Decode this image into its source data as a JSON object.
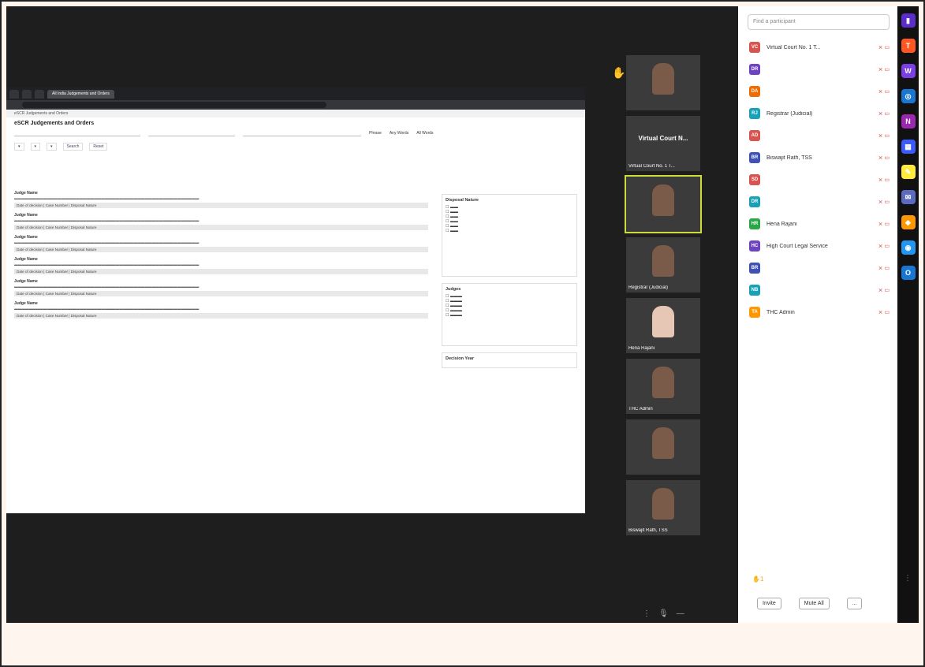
{
  "browser": {
    "tabs": [
      "",
      "",
      "",
      "All India Judgements and Orders"
    ],
    "url": "",
    "subbar": "eSCR Judgements and Orders"
  },
  "app": {
    "title": "eSCR Judgements and Orders",
    "search_placeholder": "",
    "radios": [
      "Phrase",
      "Any Words",
      "All Words"
    ],
    "tools": [
      "Search",
      "Reset"
    ]
  },
  "results": [
    {
      "title": "",
      "meta": "Judge Name",
      "bar": "Date of decision | Case Number | Disposal Nature"
    },
    {
      "title": "",
      "meta": "Judge Name",
      "bar": "Date of decision | Case Number | Disposal Nature"
    },
    {
      "title": "",
      "meta": "Judge Name",
      "bar": "Date of decision | Case Number | Disposal Nature"
    },
    {
      "title": "",
      "meta": "Judge Name",
      "bar": "Date of decision | Case Number | Disposal Nature"
    },
    {
      "title": "",
      "meta": "Judge Name",
      "bar": "Date of decision | Case Number | Disposal Nature"
    },
    {
      "title": "",
      "meta": "Judge Name",
      "bar": "Date of decision | Case Number | Disposal Nature"
    }
  ],
  "filters": {
    "box1_title": "Disposal Nature",
    "box2_title": "Judges",
    "box3_title": "Decision Year"
  },
  "videos": [
    {
      "name": "",
      "label": ""
    },
    {
      "name": "Virtual Court No. 1 T...",
      "label": "Virtual Court N..."
    },
    {
      "name": "",
      "label": ""
    },
    {
      "name": "Registrar (Judicial)",
      "label": ""
    },
    {
      "name": "Hena Rajani",
      "label": ""
    },
    {
      "name": "THC Admin",
      "label": ""
    },
    {
      "name": "",
      "label": ""
    },
    {
      "name": "Biswajit Rath, TSS",
      "label": ""
    }
  ],
  "participants": {
    "search_placeholder": "Find a participant",
    "items": [
      {
        "initials": "VC",
        "name": "Virtual Court No. 1 T...",
        "color": "#d9534f"
      },
      {
        "initials": "DR",
        "name": "",
        "color": "#6f42c1"
      },
      {
        "initials": "DA",
        "name": "",
        "color": "#ef6c00"
      },
      {
        "initials": "RJ",
        "name": "Registrar (Judicial)",
        "color": "#17a2b8"
      },
      {
        "initials": "AD",
        "name": "",
        "color": "#d9534f"
      },
      {
        "initials": "BR",
        "name": "Biswajit Rath, TSS",
        "color": "#3f51b5"
      },
      {
        "initials": "SD",
        "name": "",
        "color": "#d9534f"
      },
      {
        "initials": "DR",
        "name": "",
        "color": "#17a2b8"
      },
      {
        "initials": "HR",
        "name": "Hena Rajani",
        "color": "#28a745"
      },
      {
        "initials": "HC",
        "name": "High Court Legal Service",
        "color": "#6f42c1"
      },
      {
        "initials": "BR",
        "name": "",
        "color": "#3f51b5"
      },
      {
        "initials": "NB",
        "name": "",
        "color": "#17a2b8"
      },
      {
        "initials": "TA",
        "name": "THC Admin",
        "color": "#ff9800"
      }
    ],
    "raised_count": "1",
    "invite_label": "Invite",
    "mute_all_label": "Mute All",
    "more_label": "..."
  },
  "controls": [
    "⋮",
    "🎙",
    "—"
  ],
  "dock": [
    {
      "icon": "phone-app-icon",
      "glyph": "▮",
      "color": "#5b2ecc"
    },
    {
      "icon": "teams-icon",
      "glyph": "T",
      "color": "#ff5722"
    },
    {
      "icon": "word-icon",
      "glyph": "W",
      "color": "#7b3fe4"
    },
    {
      "icon": "edge-icon",
      "glyph": "◎",
      "color": "#1976d2"
    },
    {
      "icon": "onenote-icon",
      "glyph": "N",
      "color": "#9c27b0"
    },
    {
      "icon": "calendar-icon",
      "glyph": "▦",
      "color": "#3d5afe"
    },
    {
      "icon": "notes-icon",
      "glyph": "✎",
      "color": "#ffeb3b"
    },
    {
      "icon": "mail-icon",
      "glyph": "✉",
      "color": "#5c6bc0"
    },
    {
      "icon": "store-icon",
      "glyph": "◆",
      "color": "#ff9800"
    },
    {
      "icon": "browser-icon",
      "glyph": "◉",
      "color": "#2196f3"
    },
    {
      "icon": "outlook-icon",
      "glyph": "O",
      "color": "#1976d2"
    }
  ]
}
